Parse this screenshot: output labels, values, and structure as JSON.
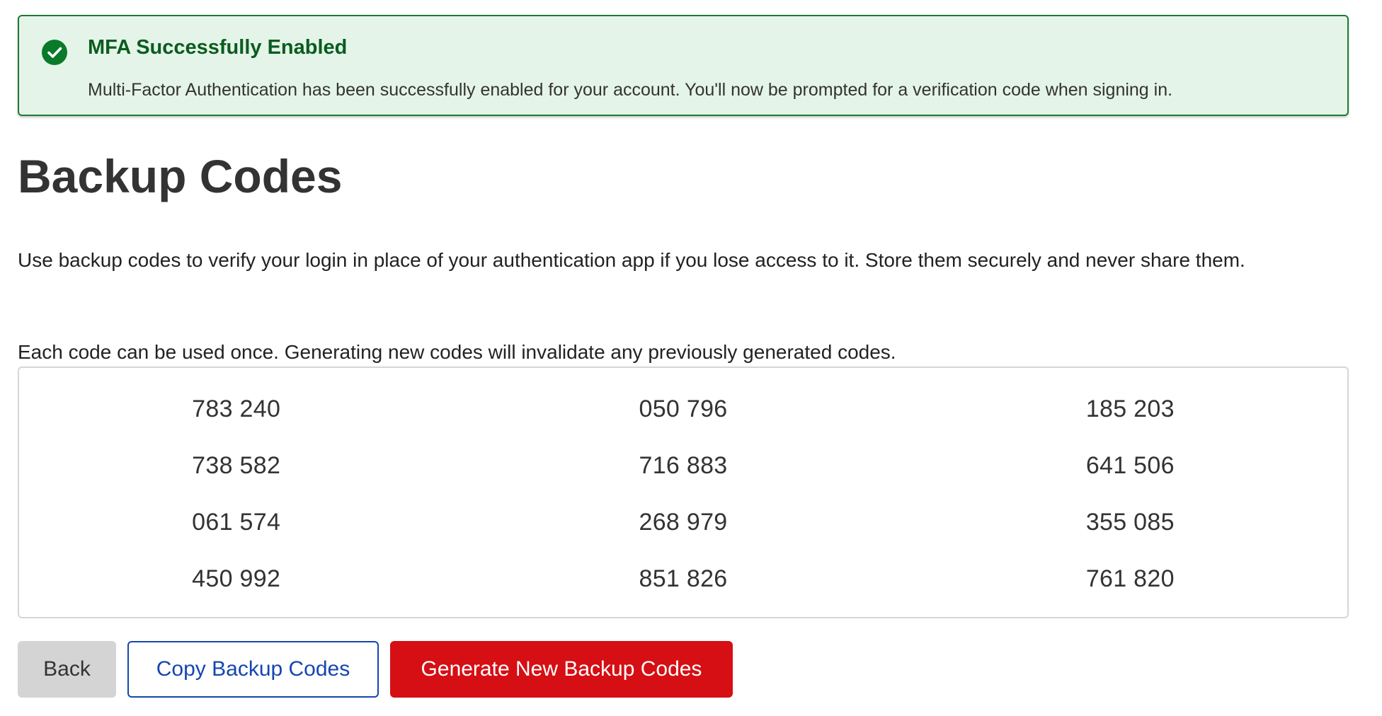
{
  "alert": {
    "icon": "check-circle-icon",
    "title": "MFA Successfully Enabled",
    "message": "Multi-Factor Authentication has been successfully enabled for your account. You'll now be prompted for a verification code when signing in.",
    "colors": {
      "background": "#e5f4e8",
      "border": "#1d7a33",
      "title": "#0a5c1f",
      "icon": "#0a7a2a"
    }
  },
  "page": {
    "title": "Backup Codes",
    "description": "Use backup codes to verify your login in place of your authentication app if you lose access to it. Store them securely and never share them.",
    "note": "Each code can be used once. Generating new codes will invalidate any previously generated codes."
  },
  "codes": [
    "783 240",
    "050 796",
    "185 203",
    "738 582",
    "716 883",
    "641 506",
    "061 574",
    "268 979",
    "355 085",
    "450 992",
    "851 826",
    "761 820"
  ],
  "actions": {
    "back_label": "Back",
    "copy_label": "Copy Backup Codes",
    "generate_label": "Generate New Backup Codes",
    "colors": {
      "primary_link": "#1546b0",
      "danger": "#d50f14",
      "neutral": "#d4d4d4"
    }
  }
}
